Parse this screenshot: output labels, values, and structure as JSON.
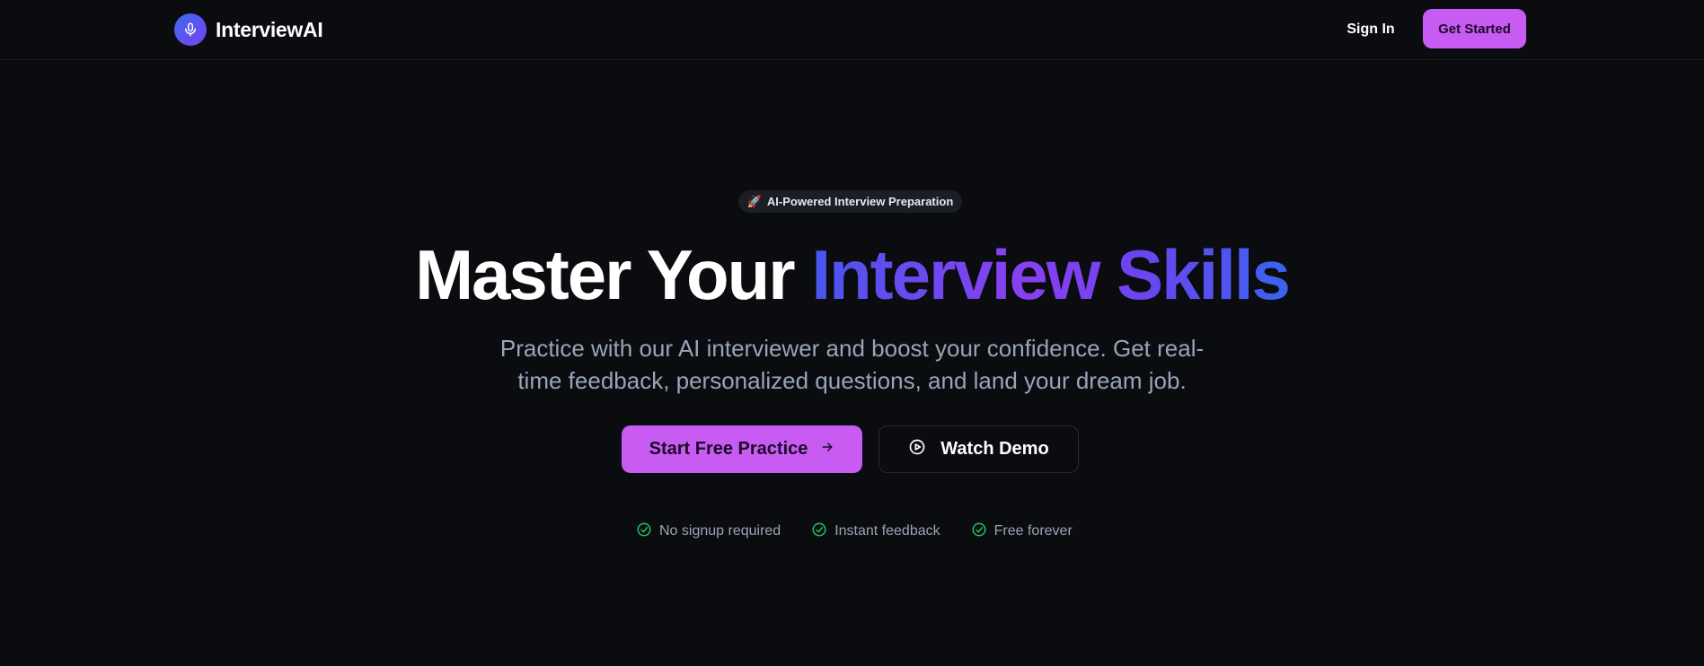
{
  "brand": {
    "name": "InterviewAI",
    "logo_icon": "microphone-icon"
  },
  "nav": {
    "sign_in": "Sign In",
    "get_started": "Get Started"
  },
  "hero": {
    "badge": {
      "icon": "🚀",
      "text": "AI-Powered Interview Preparation"
    },
    "headline_plain": "Master Your",
    "headline_highlight": "Interview Skills",
    "subtext": "Practice with our AI interviewer and boost your confidence. Get real-time feedback, personalized questions, and land your dream job.",
    "primary_cta": "Start Free Practice",
    "secondary_cta": "Watch Demo"
  },
  "features": [
    {
      "label": "No signup required",
      "icon": "check-circle-icon"
    },
    {
      "label": "Instant feedback",
      "icon": "check-circle-icon"
    },
    {
      "label": "Free forever",
      "icon": "check-circle-icon"
    }
  ],
  "colors": {
    "background": "#0b0c10",
    "accent": "#c85cf2",
    "check_green": "#22c55e",
    "gradient_start": "#4a55ee",
    "gradient_mid": "#8a3ff0",
    "gradient_end": "#3a63ee",
    "muted_text": "#98a4b8"
  }
}
